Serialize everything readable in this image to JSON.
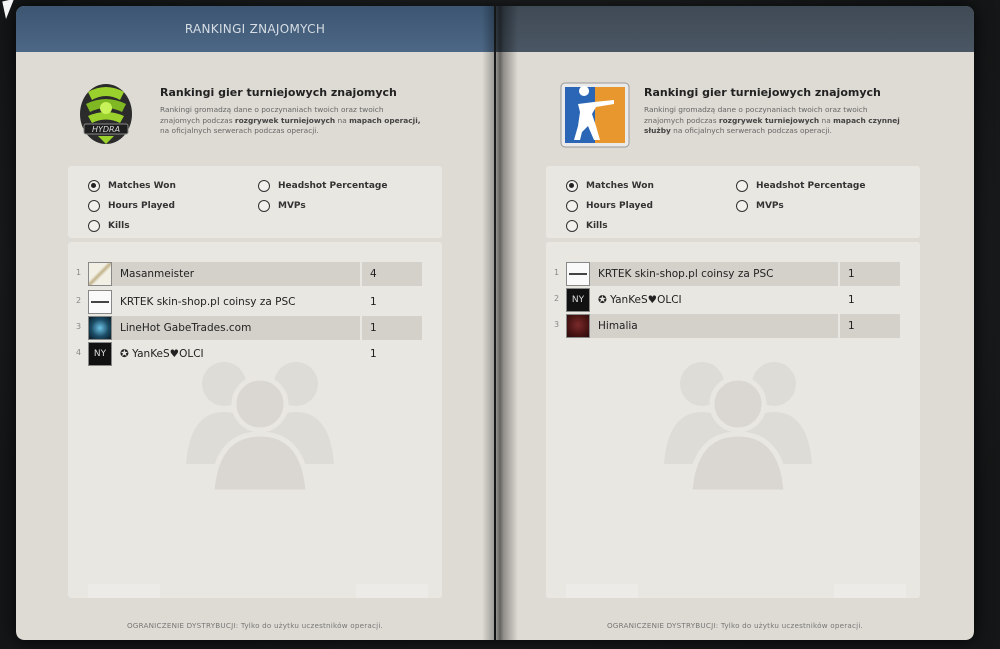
{
  "header": {
    "left_title": "RANKINGI ZNAJOMYCH",
    "right_title": ""
  },
  "left": {
    "logo": "hydra-logo",
    "logo_text": "HYDRA",
    "title": "Rankingi gier turniejowych znajomych",
    "desc_1": "Rankingi gromadzą dane o poczynaniach twoich oraz twoich",
    "desc_2a": "znajomych podczas ",
    "desc_2b": "rozgrywek turniejowych",
    "desc_2c": " na ",
    "desc_2d": "mapach operacji,",
    "desc_3": "na oficjalnych serwerach podczas operacji.",
    "filters": [
      {
        "label": "Matches Won",
        "selected": true
      },
      {
        "label": "Headshot Percentage",
        "selected": false
      },
      {
        "label": "Hours Played",
        "selected": false
      },
      {
        "label": "MVPs",
        "selected": false
      },
      {
        "label": "Kills",
        "selected": false
      }
    ],
    "rows": [
      {
        "rank": "1",
        "name": "Masanmeister",
        "score": "4"
      },
      {
        "rank": "2",
        "name": "KRTEK skin-shop.pl coinsy za PSC",
        "score": "1"
      },
      {
        "rank": "3",
        "name": "LineHot GabeTrades.com",
        "score": "1"
      },
      {
        "rank": "4",
        "name": "✪ YanKeS♥OLCI",
        "score": "1"
      }
    ],
    "footer": "OGRANICZENIE DYSTRYBUCJI: Tylko do użytku uczestników operacji."
  },
  "right": {
    "logo": "counter-strike-logo",
    "title": "Rankingi gier turniejowych znajomych",
    "desc_1": "Rankingi gromadzą dane o poczynaniach twoich oraz twoich",
    "desc_2a": "znajomych podczas ",
    "desc_2b": "rozgrywek turniejowych",
    "desc_2c": " na ",
    "desc_2d": "mapach czynnej",
    "desc_3a": "służby",
    "desc_3b": " na oficjalnych serwerach podczas operacji.",
    "filters": [
      {
        "label": "Matches Won",
        "selected": true
      },
      {
        "label": "Headshot Percentage",
        "selected": false
      },
      {
        "label": "Hours Played",
        "selected": false
      },
      {
        "label": "MVPs",
        "selected": false
      },
      {
        "label": "Kills",
        "selected": false
      }
    ],
    "rows": [
      {
        "rank": "1",
        "name": "KRTEK skin-shop.pl coinsy za PSC",
        "score": "1"
      },
      {
        "rank": "2",
        "name": "✪ YanKeS♥OLCI",
        "score": "1"
      },
      {
        "rank": "3",
        "name": "Himalia",
        "score": "1"
      }
    ],
    "footer": "OGRANICZENIE DYSTRYBUCJI: Tylko do użytku uczestników operacji."
  },
  "colors": {
    "left_header": "#4c6785",
    "right_header": "#4a5663",
    "page_bg": "#dedbd4",
    "hydra_green": "#9bd12c",
    "cs_blue": "#2a66b5",
    "cs_orange": "#e8962e"
  }
}
